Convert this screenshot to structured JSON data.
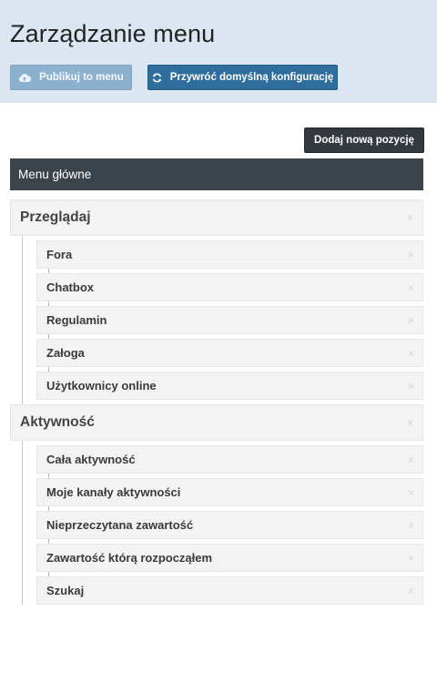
{
  "header": {
    "title": "Zarządzanie menu",
    "publish_label": "Publikuj to menu",
    "restore_label": "Przywróć domyślną konfigurację"
  },
  "toolbar": {
    "add_label": "Dodaj nową pozycję"
  },
  "menu": {
    "title": "Menu główne"
  },
  "groups": [
    {
      "label": "Przeglądaj",
      "items": [
        {
          "label": "Fora"
        },
        {
          "label": "Chatbox"
        },
        {
          "label": "Regulamin"
        },
        {
          "label": "Załoga"
        },
        {
          "label": "Użytkownicy online"
        }
      ]
    },
    {
      "label": "Aktywność",
      "items": [
        {
          "label": "Cała aktywność"
        },
        {
          "label": "Moje kanały aktywności"
        },
        {
          "label": "Nieprzeczytana zawartość"
        },
        {
          "label": "Zawartość którą rozpocząłem"
        },
        {
          "label": "Szukaj"
        }
      ]
    }
  ],
  "remove_glyph": "×",
  "colors": {
    "header_bg": "#dbe6f1",
    "publish_bg": "#8cb1cf",
    "restore_bg": "#2f6d9d",
    "add_bg": "#33393f",
    "menubar_bg": "#3b434b",
    "row_bg": "#f3f3f3",
    "remove_icon": "#c6dfc6"
  },
  "icons": {
    "publish": "cloud-upload-icon",
    "restore": "refresh-icon",
    "remove": "close-icon"
  }
}
